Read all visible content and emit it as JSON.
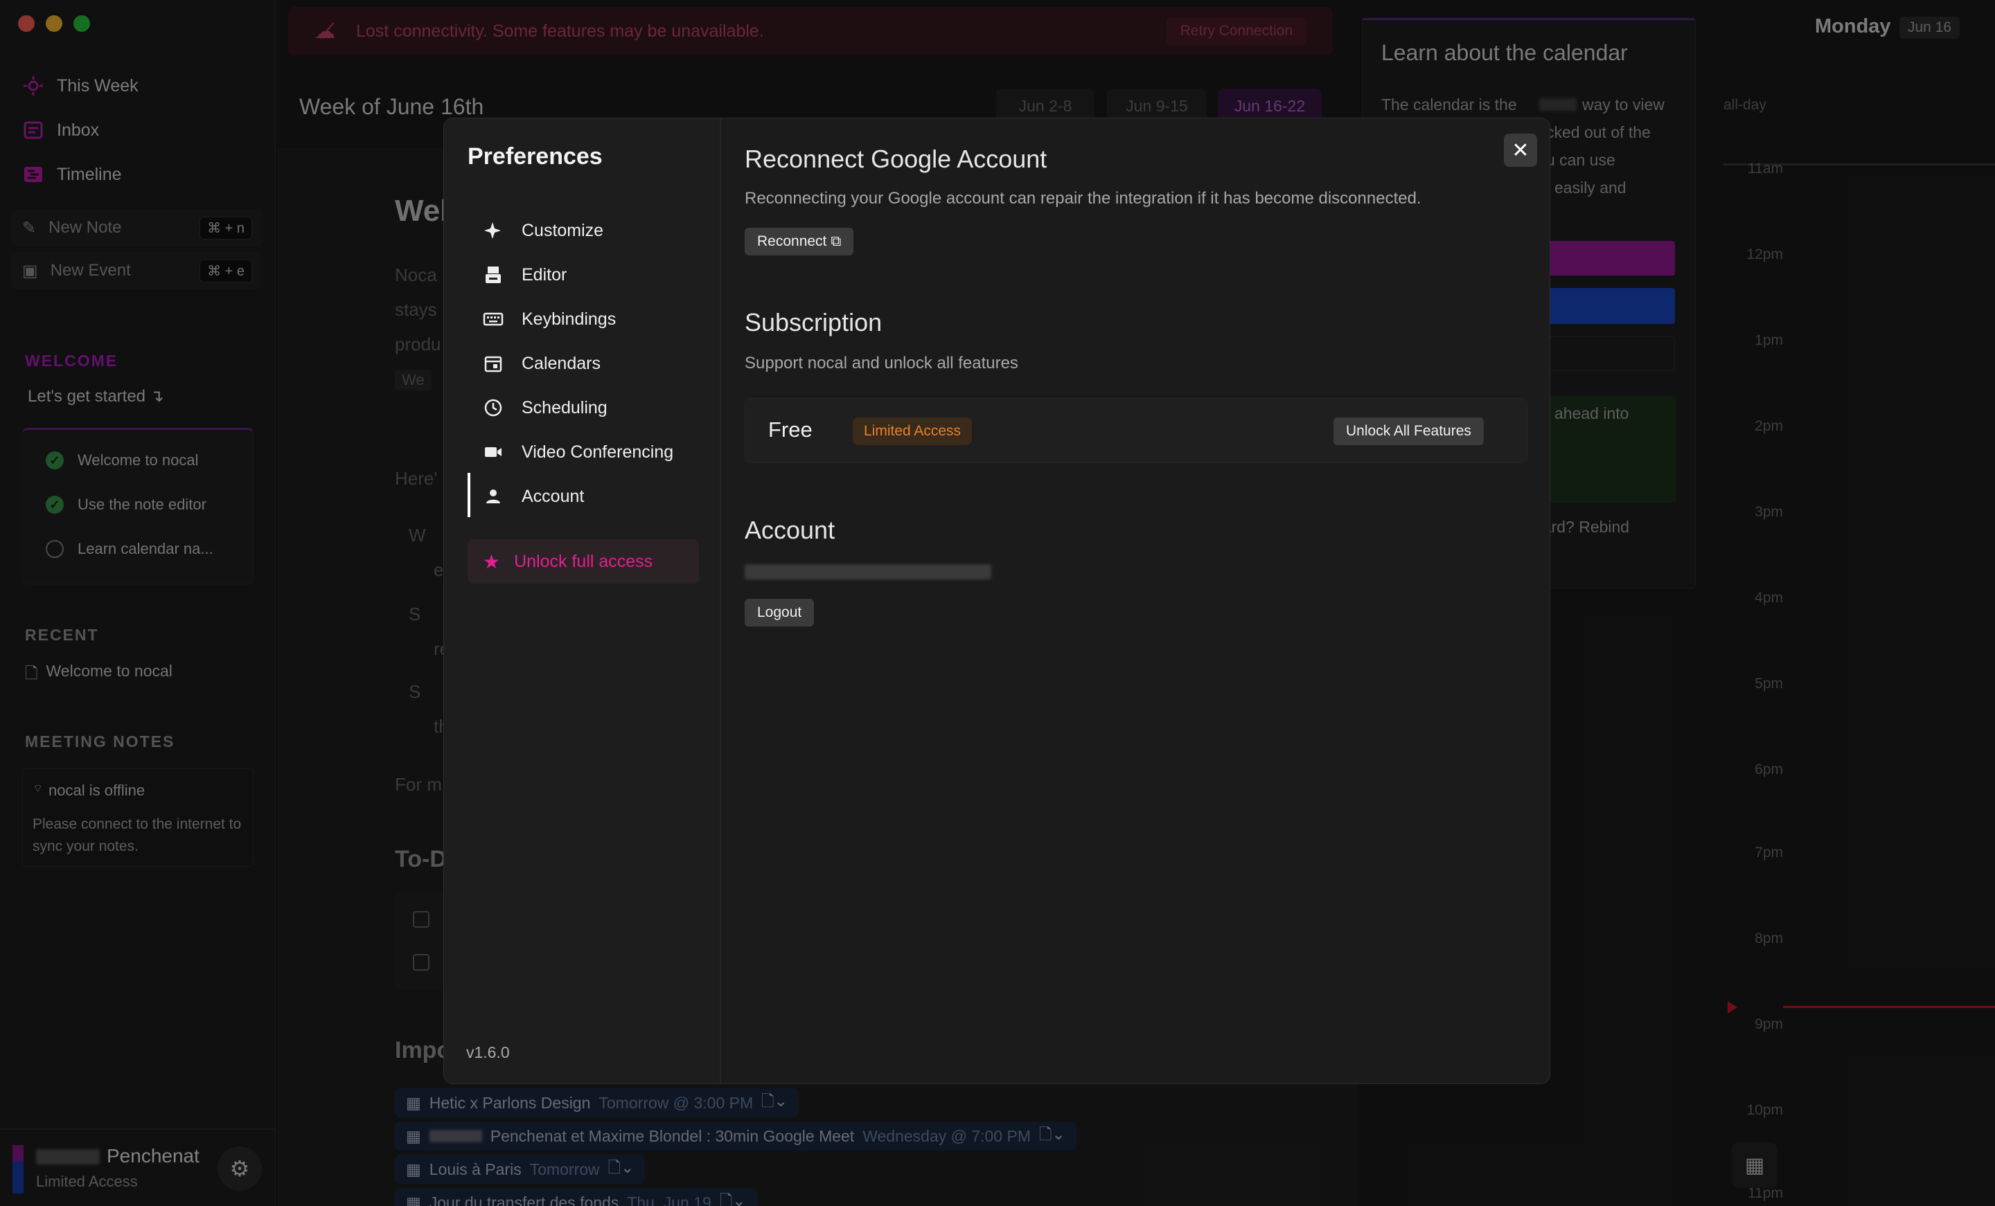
{
  "banner": {
    "message": "Lost connectivity. Some features may be unavailable.",
    "retry_label": "Retry Connection"
  },
  "sidebar": {
    "nav": [
      {
        "label": "This Week",
        "icon": "sun-icon"
      },
      {
        "label": "Inbox",
        "icon": "inbox-icon"
      },
      {
        "label": "Timeline",
        "icon": "timeline-icon"
      }
    ],
    "new_note": {
      "label": "New Note",
      "shortcut": "⌘ + n"
    },
    "new_event": {
      "label": "New Event",
      "shortcut": "⌘ + e"
    },
    "welcome_title": "WELCOME",
    "welcome_subtitle": "Let's get started ↴",
    "onboarding": [
      {
        "label": "Welcome to nocal",
        "done": true
      },
      {
        "label": "Use the note editor",
        "done": true
      },
      {
        "label": "Learn calendar na...",
        "done": false
      }
    ],
    "recent_title": "RECENT",
    "recent_item": "Welcome to nocal",
    "meeting_notes_title": "MEETING NOTES",
    "offline_title": "nocal is offline",
    "offline_text": "Please connect to the internet to sync your notes.",
    "user_name": "Penchenat",
    "user_status": "Limited Access"
  },
  "main": {
    "week_title": "Week of June 16th",
    "week_tabs": [
      "Jun 2-8",
      "Jun 9-15",
      "Jun 16-22"
    ],
    "heading": "Wel",
    "para": [
      "Noca",
      "stays",
      "produ"
    ],
    "doc_chip": "We",
    "here": "Here'",
    "bullets": [
      "W",
      "e",
      "S",
      "re",
      "S",
      "th"
    ],
    "for_m": "For m",
    "todo": "To-D",
    "imp": "Impo",
    "events": [
      {
        "title": "Hetic x Parlons Design",
        "time": "Tomorrow @ 3:00 PM"
      },
      {
        "title": "Penchenat et Maxime Blondel : 30min Google Meet",
        "time": "Wednesday @ 7:00 PM"
      },
      {
        "title": "Louis à Paris",
        "time": "Tomorrow"
      },
      {
        "title": "Jour du transfert des fonds",
        "time": "Thu, Jun 19"
      }
    ]
  },
  "calendar": {
    "day": "Monday",
    "date": "Jun 16",
    "all_day": "all-day",
    "card_title": "Learn about the calendar",
    "card_lines": [
      "The calendar is the",
      "way to view",
      "cked out of the",
      "u can use",
      "easily and"
    ],
    "card_ahead": "ahead into",
    "card_rebind": "bard? Rebind",
    "hours": [
      "11am",
      "12pm",
      "1pm",
      "2pm",
      "3pm",
      "4pm",
      "5pm",
      "6pm",
      "7pm",
      "8pm",
      "9pm",
      "10pm",
      "11pm"
    ]
  },
  "prefs": {
    "title": "Preferences",
    "menu": [
      {
        "label": "Customize",
        "icon": "sparkle-icon"
      },
      {
        "label": "Editor",
        "icon": "editor-icon"
      },
      {
        "label": "Keybindings",
        "icon": "keyboard-icon"
      },
      {
        "label": "Calendars",
        "icon": "calendar-icon"
      },
      {
        "label": "Scheduling",
        "icon": "clock-icon"
      },
      {
        "label": "Video Conferencing",
        "icon": "video-icon"
      },
      {
        "label": "Account",
        "icon": "person-icon"
      }
    ],
    "unlock_label": "Unlock full access",
    "version": "v1.6.0",
    "reconnect_title": "Reconnect Google Account",
    "reconnect_desc": "Reconnecting your Google account can repair the integration if it has become disconnected.",
    "reconnect_btn": "Reconnect",
    "sub_title": "Subscription",
    "sub_desc": "Support nocal and unlock all features",
    "plan": "Free",
    "plan_badge": "Limited Access",
    "unlock_all": "Unlock All Features",
    "account_title": "Account",
    "logout": "Logout"
  },
  "colors": {
    "accent": "#d91e8a",
    "purple": "#a020c8",
    "danger": "#c2456a",
    "now_line": "#d11a2a"
  }
}
